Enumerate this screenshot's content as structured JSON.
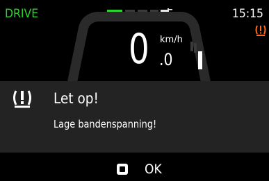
{
  "status": {
    "drive_mode": "DRIVE",
    "time": "15:15",
    "battery_level": 0.25,
    "tpms_warning_icon": "tpms-warning-icon"
  },
  "speedometer": {
    "speed_integer": "0",
    "speed_decimal": ".0",
    "unit": "km/h"
  },
  "alert": {
    "icon": "tpms-warning-icon",
    "title": "Let op!",
    "message": "Lage bandenspanning!"
  },
  "action": {
    "key_icon": "square-button-icon",
    "label": "OK"
  },
  "colors": {
    "drive_green": "#2bd52b",
    "warning_orange": "#ff6a1a",
    "panel_bg": "#222322"
  }
}
